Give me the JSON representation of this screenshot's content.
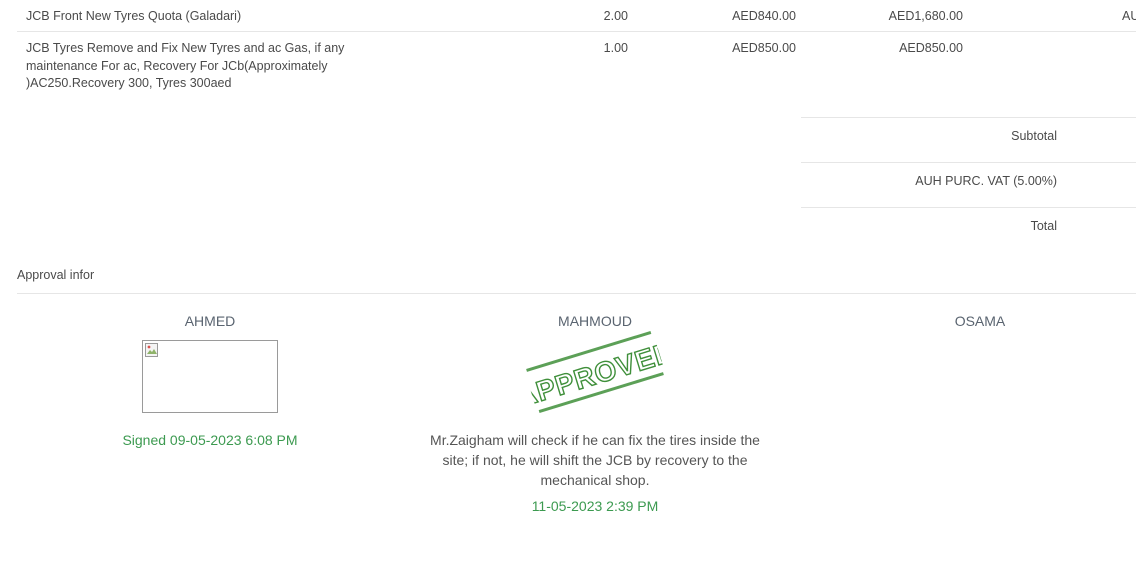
{
  "lines": [
    {
      "description": "JCB Front New Tyres Quota (Galadari)",
      "quantity": "2.00",
      "unit_price": "AED840.00",
      "subtotal": "AED1,680.00",
      "total_partial": "AU"
    },
    {
      "description": "JCB Tyres Remove and Fix New Tyres and ac Gas, if any maintenance For ac, Recovery For JCb(Approximately )AC250.Recovery 300, Tyres 300aed",
      "quantity": "1.00",
      "unit_price": "AED850.00",
      "subtotal": "AED850.00"
    }
  ],
  "summary": {
    "subtotal_label": "Subtotal",
    "vat_label": "AUH PURC. VAT (5.00%)",
    "total_label": "Total"
  },
  "approval": {
    "section_title": "Approval infor",
    "approvers": [
      {
        "name": "AHMED",
        "signed_text": "Signed 09-05-2023 6:08 PM"
      },
      {
        "name": "MAHMOUD",
        "stamp_text": "APPROVED",
        "comment": "Mr.Zaigham will check if he can fix the tires inside the site; if not, he will shift the JCB by recovery to the mechanical shop.",
        "date": "11-05-2023 2:39 PM"
      },
      {
        "name": "OSAMA"
      }
    ]
  },
  "colors": {
    "signed_green": "#3c9a50",
    "stamp_green": "#3f8f3a"
  }
}
